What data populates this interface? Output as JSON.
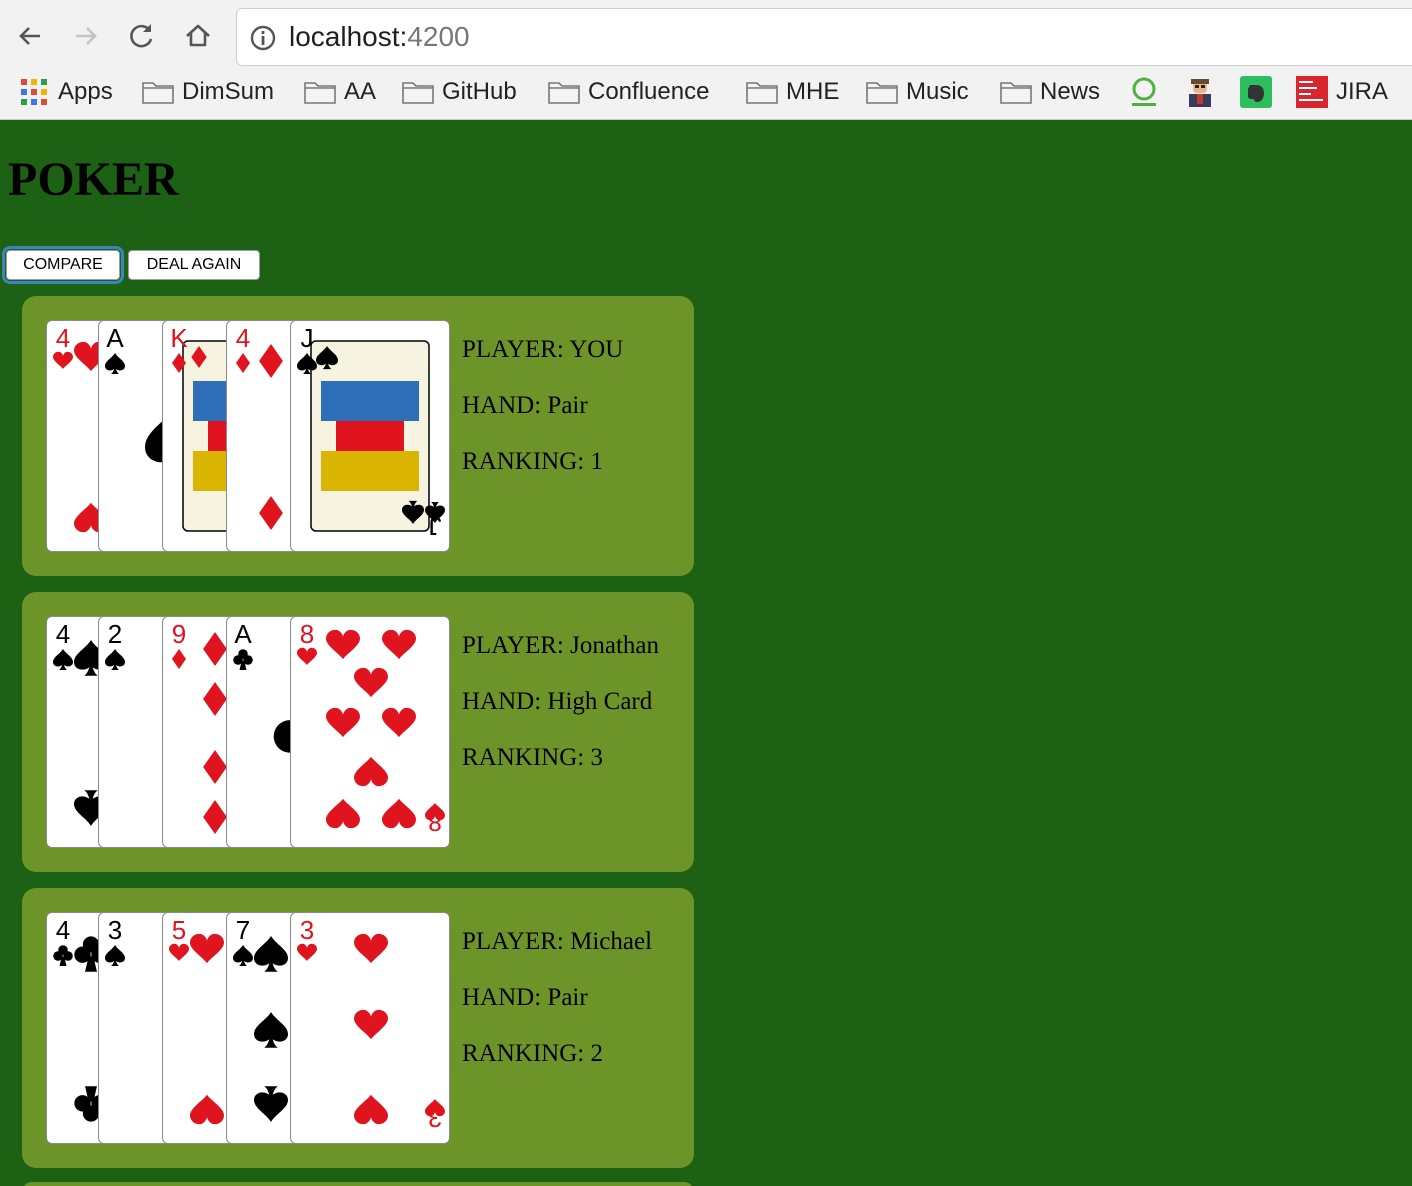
{
  "browser": {
    "url_host": "localhost:",
    "url_port": "4200",
    "bookmarks": [
      "Apps",
      "DimSum",
      "AA",
      "GitHub",
      "Confluence",
      "MHE",
      "Music",
      "News",
      "JIRA"
    ]
  },
  "page": {
    "title": "POKER",
    "compare_label": "COMPARE",
    "deal_again_label": "DEAL AGAIN"
  },
  "players": [
    {
      "player_label": "PLAYER: YOU",
      "hand_label": "HAND: Pair",
      "ranking_label": "RANKING: 1",
      "cards": [
        {
          "rank": "4",
          "suit": "hearts"
        },
        {
          "rank": "A",
          "suit": "spades"
        },
        {
          "rank": "K",
          "suit": "diamonds"
        },
        {
          "rank": "4",
          "suit": "diamonds"
        },
        {
          "rank": "J",
          "suit": "spades"
        }
      ]
    },
    {
      "player_label": "PLAYER: Jonathan",
      "hand_label": "HAND: High Card",
      "ranking_label": "RANKING: 3",
      "cards": [
        {
          "rank": "4",
          "suit": "spades"
        },
        {
          "rank": "2",
          "suit": "spades"
        },
        {
          "rank": "9",
          "suit": "diamonds"
        },
        {
          "rank": "A",
          "suit": "clubs"
        },
        {
          "rank": "8",
          "suit": "hearts"
        }
      ]
    },
    {
      "player_label": "PLAYER: Michael",
      "hand_label": "HAND: Pair",
      "ranking_label": "RANKING: 2",
      "cards": [
        {
          "rank": "4",
          "suit": "clubs"
        },
        {
          "rank": "3",
          "suit": "spades"
        },
        {
          "rank": "5",
          "suit": "hearts"
        },
        {
          "rank": "7",
          "suit": "spades"
        },
        {
          "rank": "3",
          "suit": "hearts"
        }
      ]
    }
  ],
  "colors": {
    "table_green": "#1d6114",
    "panel_green": "#6d9429",
    "red_suit": "#e0141e",
    "black_suit": "#000000",
    "focus_ring": "#3c84c1"
  }
}
